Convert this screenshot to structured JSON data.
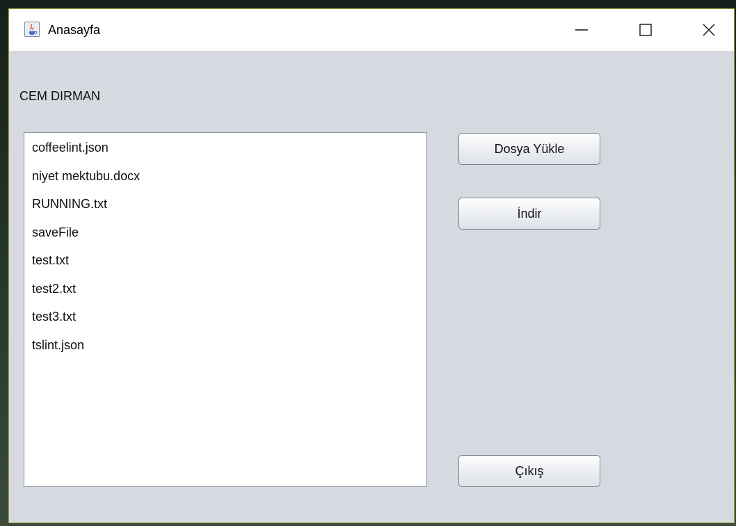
{
  "window": {
    "title": "Anasayfa",
    "icon": "java-cup-icon"
  },
  "controls": {
    "minimize_icon": "minimize-icon",
    "maximize_icon": "maximize-icon",
    "close_icon": "close-icon"
  },
  "user": {
    "name": "CEM DIRMAN"
  },
  "files": [
    "coffeelint.json",
    "niyet mektubu.docx",
    "RUNNING.txt",
    "saveFile",
    "test.txt",
    "test2.txt",
    "test3.txt",
    "tslint.json"
  ],
  "buttons": {
    "upload_label": "Dosya Yükle",
    "download_label": "İndir",
    "exit_label": "Çıkış"
  },
  "colors": {
    "window_bg": "#d6d9e0",
    "titlebar_bg": "#ffffff",
    "list_bg": "#ffffff",
    "window_border": "#9aa33a"
  }
}
